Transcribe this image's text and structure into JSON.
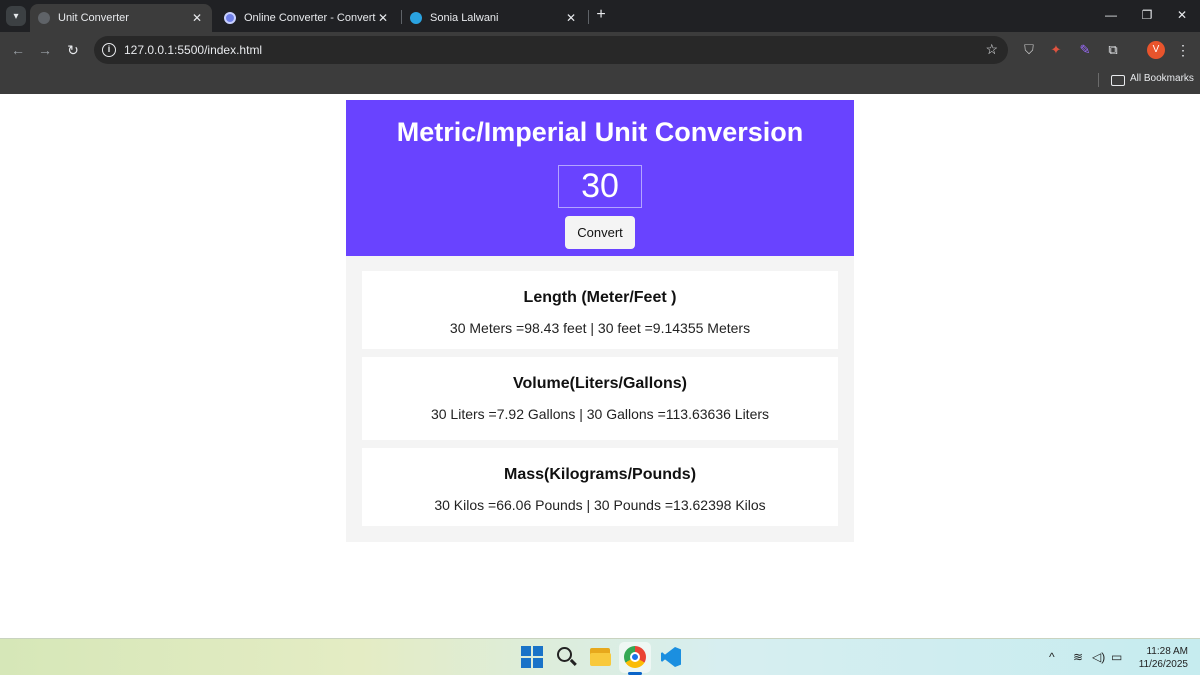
{
  "browser": {
    "tabs": [
      {
        "title": "Unit Converter",
        "active": true
      },
      {
        "title": "Online Converter - Convert Ima",
        "active": false
      },
      {
        "title": "Sonia Lalwani",
        "active": false
      }
    ],
    "url": "127.0.0.1:5500/index.html",
    "profile_initial": "V",
    "bookmarks_label": "All Bookmarks"
  },
  "page": {
    "title": "Metric/Imperial Unit Conversion",
    "input_value": "30",
    "convert_label": "Convert",
    "cards": [
      {
        "title": "Length (Meter/Feet )",
        "text": "30 Meters =98.43 feet | 30 feet =9.14355 Meters"
      },
      {
        "title": "Volume(Liters/Gallons)",
        "text": "30 Liters =7.92 Gallons | 30 Gallons =113.63636 Liters"
      },
      {
        "title": "Mass(Kilograms/Pounds)",
        "text": "30 Kilos =66.06 Pounds | 30 Pounds =13.62398 Kilos"
      }
    ]
  },
  "taskbar": {
    "time": "11:28 AM",
    "date": "11/26/2025"
  },
  "colors": {
    "accent": "#6943ff",
    "results_bg": "#f4f4f4"
  }
}
